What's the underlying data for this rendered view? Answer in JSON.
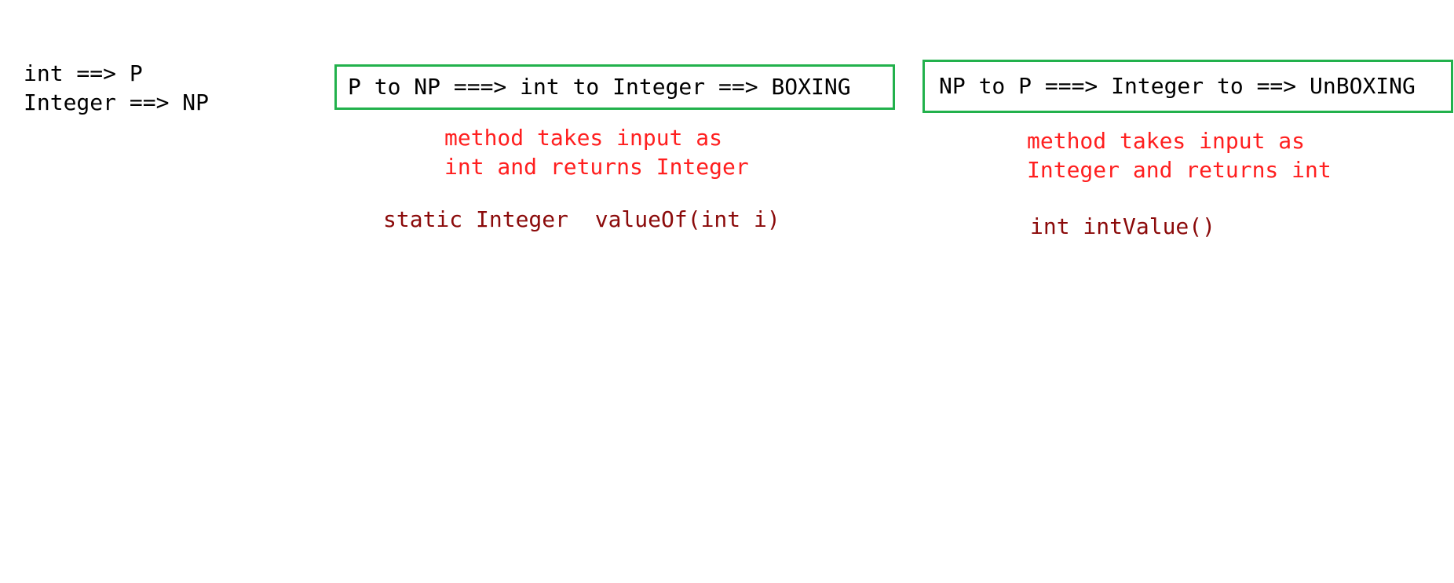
{
  "legend": {
    "line1": "int ==> P",
    "line2": "Integer ==> NP"
  },
  "boxing": {
    "box_text": "P to NP ===> int to Integer ==> BOXING",
    "note_line1": "method takes input as",
    "note_line2": "int and returns Integer",
    "method": "static Integer  valueOf(int i)"
  },
  "unboxing": {
    "box_text": "NP to P ===> Integer to ==> UnBOXING",
    "note_line1": "method takes input as",
    "note_line2": "Integer and returns int",
    "method": "int intValue()"
  },
  "colors": {
    "box_border": "#22b14c",
    "note_text": "#ff1f1f",
    "method_text": "#8b0a0a",
    "plain_text": "#000000"
  }
}
